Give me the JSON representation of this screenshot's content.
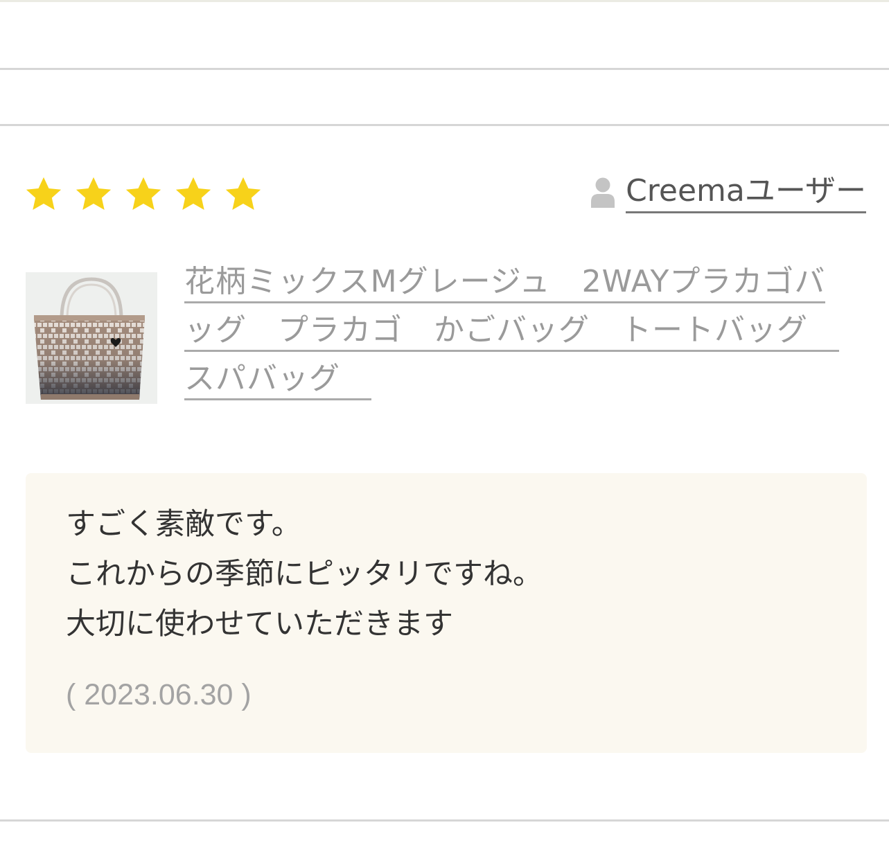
{
  "review": {
    "rating": 5,
    "max_rating": 5,
    "star_color": "#f7d21a",
    "user_name": "Creemaユーザー",
    "product_title": "花柄ミックスMグレージュ　2WAYプラカゴバッグ　プラカゴ　かごバッグ　トートバッグ　スパバッグ　",
    "comment_lines": [
      "すごく素敵です。",
      "これからの季節にピッタリですね。",
      "大切に使わせていただきます"
    ],
    "date": "( 2023.06.30 )"
  },
  "icons": {
    "star": "star-icon",
    "user": "user-silhouette-icon"
  }
}
